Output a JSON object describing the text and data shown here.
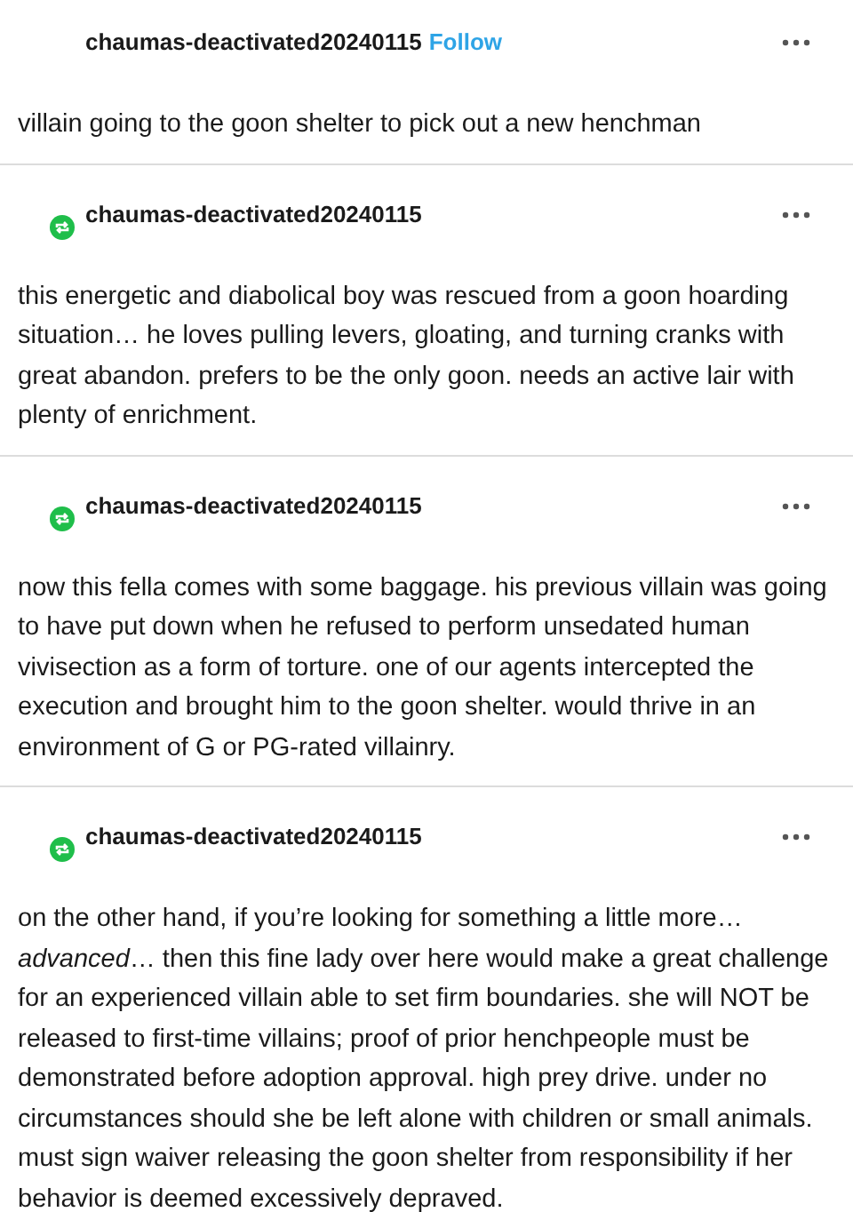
{
  "posts": [
    {
      "username": "chaumas-deactivated20240115",
      "follow": "Follow",
      "reblogged": false,
      "body": "villain going to the goon shelter to pick out a new henchman"
    },
    {
      "username": "chaumas-deactivated20240115",
      "reblogged": true,
      "body": "this energetic and diabolical boy was rescued from a goon hoarding situation… he loves pulling levers, gloating, and turning cranks with great abandon. prefers to be the only goon. needs an active lair with plenty of enrichment."
    },
    {
      "username": "chaumas-deactivated20240115",
      "reblogged": true,
      "body": "now this fella comes with some baggage. his previous villain was going to have put down when he refused to perform unsedated human vivisection as a form of torture. one of our agents intercepted the execution and brought him to the goon shelter. would thrive in an environment of G or PG-rated villainry."
    },
    {
      "username": "chaumas-deactivated20240115",
      "reblogged": true,
      "body": "on the other hand, if you’re looking for something a little more… *advanced*… then this fine lady over here would make a great challenge for an experienced villain able to set firm boundaries. she will NOT be released to first-time villains; proof of prior henchpeople must be demonstrated before adoption approval. high prey drive. under no circumstances should she be left alone with children or small animals. must sign waiver releasing the goon shelter from responsibility if her behavior is deemed excessively depraved."
    }
  ]
}
